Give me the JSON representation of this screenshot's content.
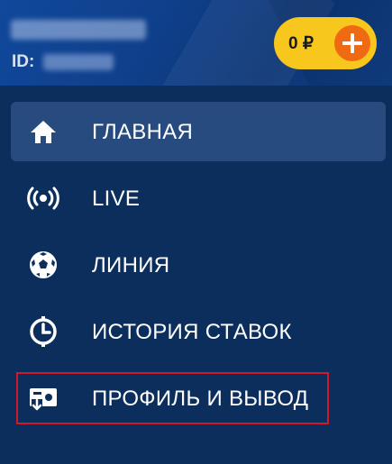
{
  "user": {
    "id_label": "ID:"
  },
  "balance": {
    "amount": "0 ₽",
    "accent_color": "#f7c71d",
    "add_button_color": "#ef6a12",
    "add_icon": "plus-icon"
  },
  "menu": {
    "items": [
      {
        "label": "ГЛАВНАЯ",
        "icon": "home-icon",
        "active": true
      },
      {
        "label": "LIVE",
        "icon": "live-broadcast-icon",
        "active": false
      },
      {
        "label": "ЛИНИЯ",
        "icon": "soccer-ball-icon",
        "active": false
      },
      {
        "label": "ИСТОРИЯ СТАВОК",
        "icon": "clock-history-icon",
        "active": false
      },
      {
        "label": "ПРОФИЛЬ И ВЫВОД",
        "icon": "wallet-withdraw-icon",
        "active": false,
        "highlighted": true
      }
    ]
  },
  "colors": {
    "background": "#0b2e5c",
    "active_item": "#274b7f",
    "highlight_border": "#d4182b"
  }
}
